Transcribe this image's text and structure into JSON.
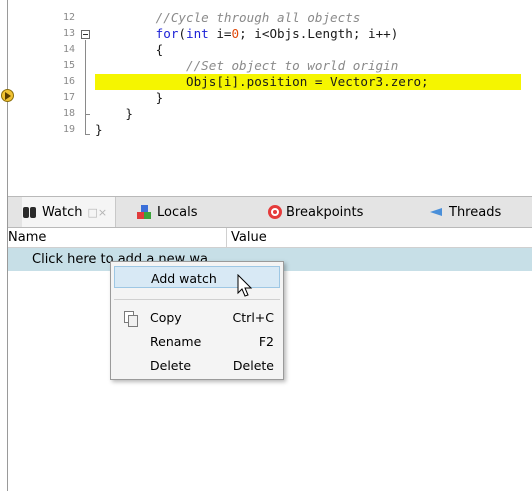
{
  "editor": {
    "lines": [
      {
        "num": "12",
        "tokens": [
          {
            "t": "        //Cycle through all objects",
            "c": "comment"
          }
        ]
      },
      {
        "num": "13",
        "tokens": [
          {
            "t": "        ",
            "c": ""
          },
          {
            "t": "for",
            "c": "kw"
          },
          {
            "t": "(",
            "c": ""
          },
          {
            "t": "int",
            "c": "kw"
          },
          {
            "t": " i=",
            "c": ""
          },
          {
            "t": "0",
            "c": "num"
          },
          {
            "t": "; i<Objs.Length; i++)",
            "c": ""
          }
        ]
      },
      {
        "num": "14",
        "tokens": [
          {
            "t": "        {",
            "c": ""
          }
        ]
      },
      {
        "num": "15",
        "tokens": [
          {
            "t": "            //Set object to world origin",
            "c": "comment"
          }
        ]
      },
      {
        "num": "16",
        "tokens": [
          {
            "t": "            Objs[i].position = Vector3.zero;",
            "c": ""
          }
        ],
        "highlight": true
      },
      {
        "num": "17",
        "tokens": [
          {
            "t": "        }",
            "c": ""
          }
        ]
      },
      {
        "num": "18",
        "tokens": [
          {
            "t": "    }",
            "c": ""
          }
        ]
      },
      {
        "num": "19",
        "tokens": [
          {
            "t": "}",
            "c": ""
          }
        ]
      }
    ]
  },
  "tabs": [
    {
      "label": "Watch",
      "close": "□×",
      "icon": "binoculars-icon"
    },
    {
      "label": "Locals",
      "icon": "locals-icon"
    },
    {
      "label": "Breakpoints",
      "icon": "breakpoint-target-icon"
    },
    {
      "label": "Threads",
      "icon": "threads-icon"
    }
  ],
  "watch": {
    "col_name": "Name",
    "col_value": "Value",
    "add_row": "Click here to add a new wa"
  },
  "context_menu": {
    "items": [
      {
        "label": "Add watch",
        "shortcut": ""
      },
      {
        "label": "Copy",
        "shortcut": "Ctrl+C"
      },
      {
        "label": "Rename",
        "shortcut": "F2"
      },
      {
        "label": "Delete",
        "shortcut": "Delete"
      }
    ]
  },
  "colors": {
    "highlight": "#f5f500",
    "keyword": "#1a1fd6",
    "comment": "#8a8a8a",
    "number": "#e24a0b",
    "add_row_bg": "#c7dfe7",
    "menu_hover": "#d8e9f5"
  }
}
